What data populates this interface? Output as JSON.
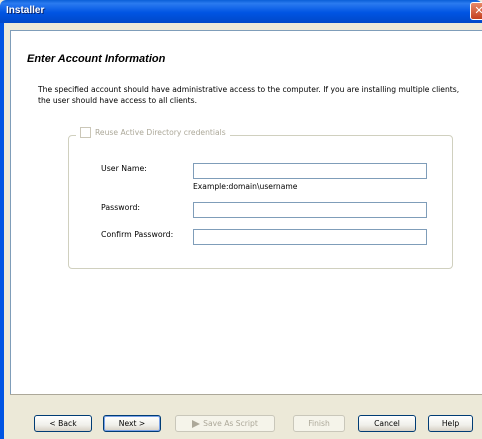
{
  "window": {
    "title": "Installer"
  },
  "page": {
    "heading": "Enter Account Information",
    "description": "The specified account should have administrative access to the computer. If you are installing multiple clients, the user should have access to all clients."
  },
  "credentials": {
    "reuse_checkbox_label": "Reuse Active Directory credentials",
    "reuse_checked": false,
    "username_label": "User Name:",
    "username_value": "",
    "username_hint": "Example:domain\\username",
    "password_label": "Password:",
    "password_value": "",
    "confirm_label": "Confirm Password:",
    "confirm_value": ""
  },
  "buttons": {
    "back": "< Back",
    "next": "Next >",
    "save_script": "Save As Script",
    "finish": "Finish",
    "cancel": "Cancel",
    "help": "Help"
  },
  "icons": {
    "close": "close-icon",
    "save_script": "script-icon"
  }
}
